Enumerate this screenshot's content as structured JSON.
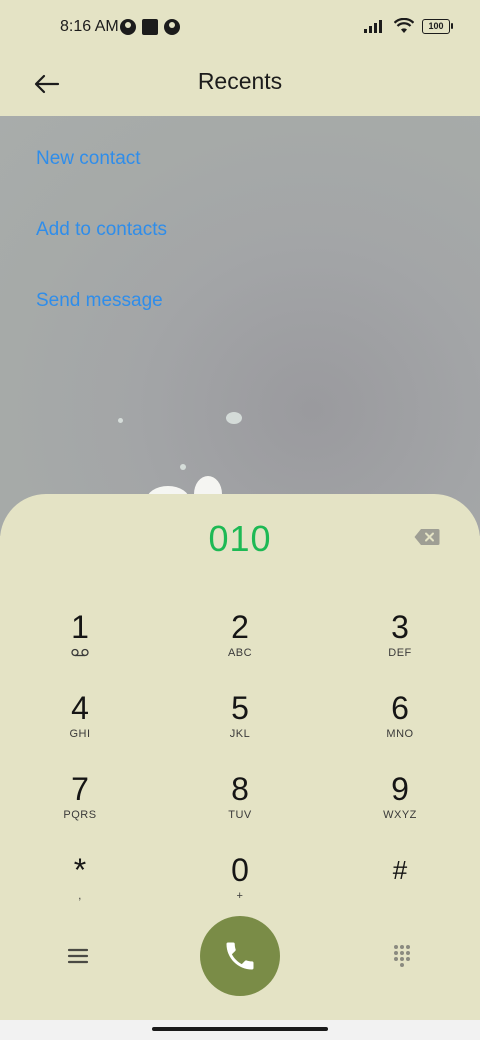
{
  "status_bar": {
    "time": "8:16 AM",
    "battery": "100",
    "icons": [
      "notification-round-icon",
      "notification-square-icon",
      "notification-round-icon",
      "signal-icon",
      "wifi-icon",
      "battery-icon"
    ]
  },
  "header": {
    "title": "Recents",
    "back_icon": "back-arrow-icon"
  },
  "actions": {
    "new_contact": "New contact",
    "add_to_contacts": "Add to contacts",
    "send_message": "Send message"
  },
  "dialer": {
    "number": "010",
    "backspace_icon": "backspace-icon",
    "keys": [
      {
        "digit": "1",
        "sub": ""
      },
      {
        "digit": "2",
        "sub": "ABC"
      },
      {
        "digit": "3",
        "sub": "DEF"
      },
      {
        "digit": "4",
        "sub": "GHI"
      },
      {
        "digit": "5",
        "sub": "JKL"
      },
      {
        "digit": "6",
        "sub": "MNO"
      },
      {
        "digit": "7",
        "sub": "PQRS"
      },
      {
        "digit": "8",
        "sub": "TUV"
      },
      {
        "digit": "9",
        "sub": "WXYZ"
      },
      {
        "digit": "*",
        "sub": ","
      },
      {
        "digit": "0",
        "sub": "+"
      },
      {
        "digit": "#",
        "sub": ""
      }
    ],
    "menu_icon": "menu-icon",
    "call_icon": "phone-icon",
    "keypad_icon": "keypad-icon"
  },
  "colors": {
    "background": "#e4e3c5",
    "accent_link": "#2f8dea",
    "number_green": "#1db954",
    "call_button": "#7a8c47"
  }
}
